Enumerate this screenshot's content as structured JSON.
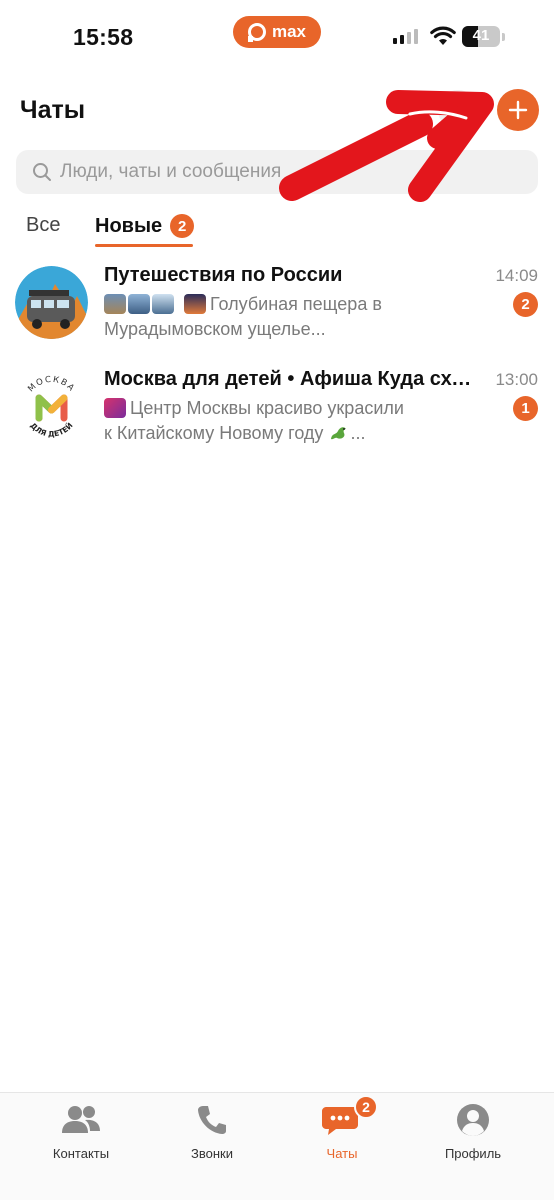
{
  "status_bar": {
    "time": "15:58",
    "carrier_label": "max",
    "battery_percent": "41",
    "battery_level": 0.41
  },
  "header": {
    "title": "Чаты",
    "add_icon": "plus-icon"
  },
  "search": {
    "placeholder": "Люди, чаты и сообщения",
    "icon": "search-icon"
  },
  "tabs": [
    {
      "label": "Все",
      "active": false
    },
    {
      "label": "Новые",
      "active": true,
      "badge": "2"
    }
  ],
  "chats": [
    {
      "title": "Путешествия по России",
      "preview": "Голубиная пещера в Мурадымовском ущелье...",
      "time": "14:09",
      "unread": "2"
    },
    {
      "title": "Москва для детей • Афиша Куда сходить с ребенком",
      "preview_part1": "Центр Москвы красиво украсили к Китайскому Новому году",
      "preview_part2": "...",
      "time": "13:00",
      "unread": "1",
      "avatar_text_top": "МОСКВА",
      "avatar_text_bottom": "ДЛЯ ДЕТЕЙ"
    }
  ],
  "bottom_nav": [
    {
      "label": "Контакты",
      "icon": "contacts-icon"
    },
    {
      "label": "Звонки",
      "icon": "phone-icon"
    },
    {
      "label": "Чаты",
      "icon": "chat-bubble-icon",
      "badge": "2",
      "active": true
    },
    {
      "label": "Профиль",
      "icon": "profile-icon"
    }
  ],
  "colors": {
    "accent": "#e8652a",
    "annotation_arrow": "#e3161c"
  }
}
